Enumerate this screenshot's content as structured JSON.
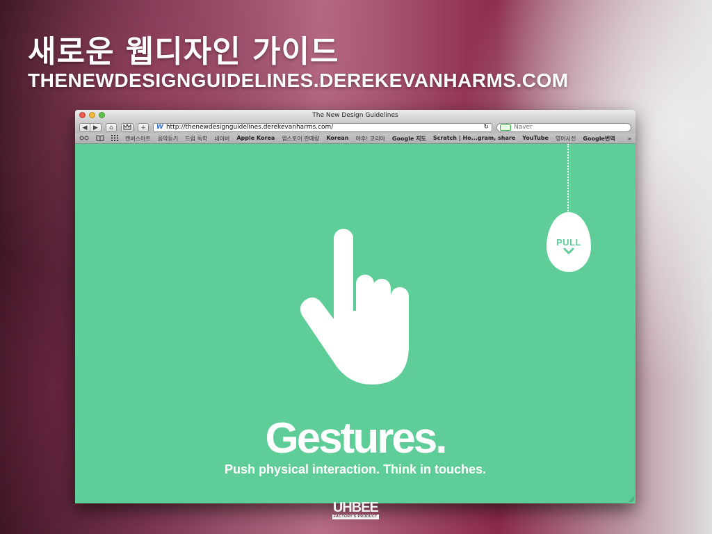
{
  "slide": {
    "title": "새로운 웹디자인 가이드",
    "url": "THENEWDESIGNGUIDELINES.DEREKEVANHARMS.COM"
  },
  "browser": {
    "window_title": "The New Design Guidelines",
    "address": "http://thenewdesignguidelines.derekevanharms.com/",
    "search_placeholder": "Naver",
    "back_icon": "◀",
    "forward_icon": "▶",
    "home_icon": "⌂",
    "add_icon": "+",
    "reload_icon": "↻",
    "site_icon": "W",
    "bookmarks": [
      {
        "label": "캔버스아트",
        "bold": false
      },
      {
        "label": "음악듣기",
        "bold": false
      },
      {
        "label": "드럼 독학",
        "bold": false
      },
      {
        "label": "네이버",
        "bold": false
      },
      {
        "label": "Apple Korea",
        "bold": true
      },
      {
        "label": "앱스토어 판매량",
        "bold": false
      },
      {
        "label": "Korean",
        "bold": true
      },
      {
        "label": "야후! 코리아",
        "bold": false
      },
      {
        "label": "Google 지도",
        "bold": true
      },
      {
        "label": "Scratch | Ho...gram, share",
        "bold": true
      },
      {
        "label": "YouTube",
        "bold": true
      },
      {
        "label": "영어사전",
        "bold": false
      },
      {
        "label": "Google번역",
        "bold": true
      }
    ],
    "more_label": "»"
  },
  "page": {
    "background_color": "#5fcd97",
    "heading": "Gestures.",
    "subheading": "Push physical interaction. Think in touches.",
    "pull_label": "PULL"
  },
  "watermark": {
    "main": "UHBEE",
    "sub": "FACTORY'S PRODUCT"
  },
  "colors": {
    "accent_green": "#5fcd97",
    "traffic_red": "#ee5a52",
    "traffic_yellow": "#f6b73c",
    "traffic_green": "#5fc24b"
  }
}
